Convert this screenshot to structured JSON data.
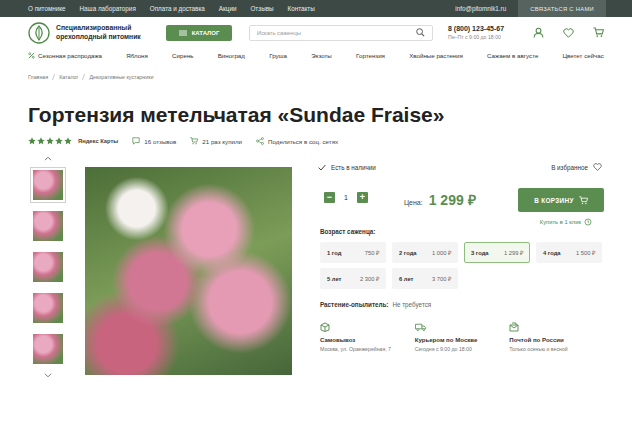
{
  "topbar": {
    "links": [
      "О питомнике",
      "Наша лаборатория",
      "Оплата и доставка",
      "Акции",
      "Отзывы",
      "Контакты"
    ],
    "email": "info@pitomnik1.ru",
    "contact_button": "СВЯЗАТЬСЯ С НАМИ"
  },
  "header": {
    "logo_lines": [
      "Специализированный",
      "орехоплодный питомник"
    ],
    "catalog_button": "КАТАЛОГ",
    "search": {
      "placeholder": "Искать саженцы"
    },
    "phone": "8 (800) 123-45-67",
    "hours": "Пн–Пт с 9:00 до 18:00"
  },
  "nav": {
    "sale": "Сезонная распродажа",
    "items": [
      "Яблоня",
      "Сирень",
      "Виноград",
      "Груша",
      "Экзоты",
      "Гортензия",
      "Хвойные растения",
      "Сажаем в августе",
      "Цветет сейчас"
    ]
  },
  "breadcrumbs": [
    "Главная",
    "Каталог",
    "Декоративные кустарники"
  ],
  "product": {
    "title": "Гортензия метельчатая «Sundae Fraise»",
    "stars": 5,
    "rating_source": "Яндекс Карты",
    "reviews": "16 отзывов",
    "bought": "21 раз купили",
    "share": "Поделиться в соц. сетях"
  },
  "thumbnails": [
    {
      "selected": true
    },
    {
      "selected": false
    },
    {
      "selected": false
    },
    {
      "selected": false
    },
    {
      "selected": false
    }
  ],
  "stock": "Есть в наличии",
  "favorite": "В избранное",
  "quantity": {
    "minus": "−",
    "value": "1",
    "plus": "+"
  },
  "price_label": "Цена:",
  "price": "1 299 ₽",
  "cart_button": "В КОРЗИНУ",
  "one_click": "Купить в 1 клик",
  "age": {
    "label": "Возраст саженца:",
    "options": [
      {
        "label": "1 год",
        "price": "750 ₽",
        "selected": false
      },
      {
        "label": "2 года",
        "price": "1 000 ₽",
        "selected": false
      },
      {
        "label": "3 года",
        "price": "1 299 ₽",
        "selected": true
      },
      {
        "label": "4 года",
        "price": "1 500 ₽",
        "selected": false
      },
      {
        "label": "5 лет",
        "price": "2 300 ₽",
        "selected": false
      },
      {
        "label": "6 лет",
        "price": "3 700 ₽",
        "selected": false
      }
    ]
  },
  "pollinator": {
    "label": "Растение-опылитель:",
    "value": "Не требуется"
  },
  "delivery": [
    {
      "kind": "pickup",
      "title": "Самовывоз",
      "text": "Москва, ул. Оранжерейная, 7"
    },
    {
      "kind": "courier",
      "title": "Курьером по Москве",
      "text": "Сегодня с 9:00 до 18:00"
    },
    {
      "kind": "post",
      "title": "Почтой по России",
      "text": "Только осенью и весной"
    }
  ]
}
